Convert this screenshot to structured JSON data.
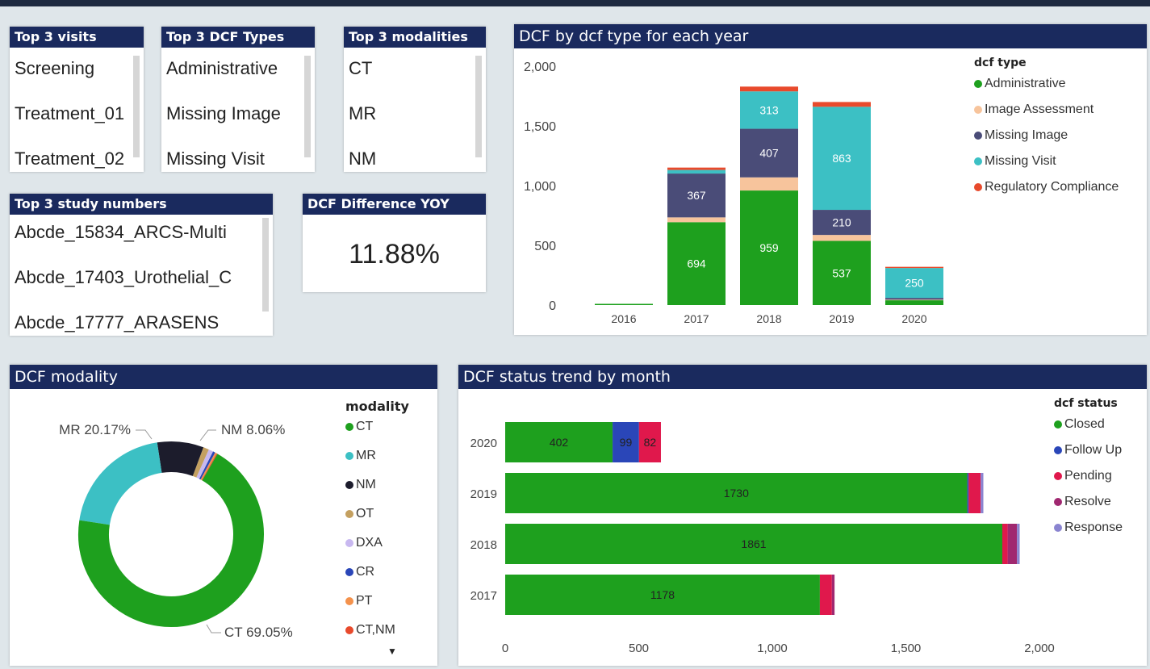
{
  "slicers": [
    {
      "title": "Top 3 visits",
      "items": [
        "Screening",
        "Treatment_01",
        "Treatment_02"
      ]
    },
    {
      "title": "Top 3 DCF Types",
      "items": [
        "Administrative",
        "Missing Image",
        "Missing Visit"
      ]
    },
    {
      "title": "Top 3 modalities",
      "items": [
        "CT",
        "MR",
        "NM"
      ]
    },
    {
      "title": "Top 3 study numbers",
      "items": [
        "Abcde_15834_ARCS-Multi",
        "Abcde_17403_Urothelial_C",
        "Abcde_17777_ARASENS"
      ]
    }
  ],
  "kpi": {
    "title": "DCF Difference YOY",
    "value": "11.88%"
  },
  "dcf_type_chart": {
    "title": "DCF by dcf type for each year",
    "legend_title": "dcf type",
    "colors": {
      "Administrative": "#1ea01e",
      "Image Assessment": "#f7c49c",
      "Missing Image": "#4a4c78",
      "Missing Visit": "#3cc0c4",
      "Regulatory Compliance": "#e84a2c"
    }
  },
  "modality_chart": {
    "title": "DCF modality",
    "legend_title": "modality",
    "more_icon": "chevron-down-icon",
    "labels": {
      "MR": "MR 20.17%",
      "NM": "NM 8.06%",
      "CT": "CT 69.05%"
    },
    "colors": [
      "#1ea01e",
      "#3cc0c4",
      "#1c1c2c",
      "#c4a060",
      "#c8b8f0",
      "#2a46b8",
      "#f4924c",
      "#e84a2c"
    ]
  },
  "status_chart": {
    "title": "DCF status trend by month",
    "legend_title": "dcf status",
    "colors": {
      "Closed": "#1ea01e",
      "Follow Up": "#2a46b8",
      "Pending": "#e0184c",
      "Resolve": "#a02870",
      "Response": "#8a84d0"
    }
  },
  "chart_data": [
    {
      "type": "bar",
      "stacked": true,
      "title": "DCF by dcf type for each year",
      "categories": [
        "2016",
        "2017",
        "2018",
        "2019",
        "2020"
      ],
      "series": [
        {
          "name": "Administrative",
          "values": [
            10,
            694,
            959,
            537,
            40
          ]
        },
        {
          "name": "Image Assessment",
          "values": [
            0,
            40,
            110,
            50,
            5
          ]
        },
        {
          "name": "Missing Image",
          "values": [
            0,
            367,
            407,
            210,
            15
          ]
        },
        {
          "name": "Missing Visit",
          "values": [
            0,
            30,
            313,
            863,
            250
          ]
        },
        {
          "name": "Regulatory Compliance",
          "values": [
            0,
            20,
            40,
            40,
            10
          ]
        }
      ],
      "data_labels": {
        "Administrative": [
          null,
          "694",
          "959",
          "537",
          null
        ],
        "Missing Image": [
          null,
          "367",
          "407",
          "210",
          null
        ],
        "Missing Visit": [
          null,
          null,
          "313",
          "863",
          "250"
        ]
      },
      "y_ticks": [
        "0",
        "500",
        "1,000",
        "1,500",
        "2,000"
      ],
      "ylim": [
        0,
        2000
      ],
      "grid": false,
      "legend": "right"
    },
    {
      "type": "pie",
      "donut": true,
      "title": "DCF modality",
      "categories": [
        "CT",
        "MR",
        "NM",
        "OT",
        "DXA",
        "CR",
        "PT",
        "CT,NM"
      ],
      "values": [
        69.05,
        20.17,
        8.06,
        1.0,
        0.8,
        0.4,
        0.3,
        0.21
      ],
      "legend": "right"
    },
    {
      "type": "bar",
      "orientation": "horizontal",
      "stacked": true,
      "title": "DCF status trend by month",
      "categories": [
        "2020",
        "2019",
        "2018",
        "2017"
      ],
      "series": [
        {
          "name": "Closed",
          "values": [
            402,
            1730,
            1861,
            1178
          ]
        },
        {
          "name": "Follow Up",
          "values": [
            99,
            5,
            0,
            0
          ]
        },
        {
          "name": "Pending",
          "values": [
            82,
            45,
            20,
            45
          ]
        },
        {
          "name": "Resolve",
          "values": [
            0,
            0,
            35,
            10
          ]
        },
        {
          "name": "Response",
          "values": [
            0,
            10,
            10,
            0
          ]
        }
      ],
      "data_labels": {
        "Closed": [
          "402",
          "1730",
          "1861",
          "1178"
        ],
        "Follow Up": [
          "99",
          null,
          null,
          null
        ],
        "Pending": [
          "82",
          null,
          null,
          null
        ]
      },
      "x_ticks": [
        "0",
        "500",
        "1,000",
        "1,500",
        "2,000"
      ],
      "xlim": [
        0,
        2000
      ],
      "grid": false,
      "legend": "right"
    }
  ]
}
